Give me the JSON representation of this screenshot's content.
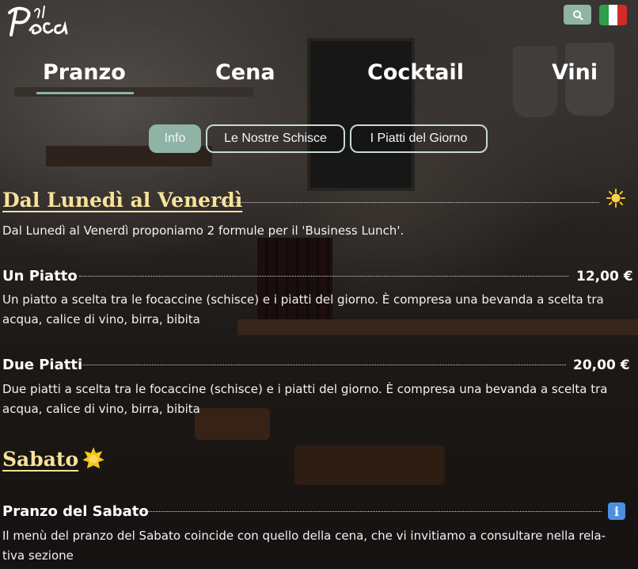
{
  "colors": {
    "accent": "#8fb3a4",
    "title": "#f7e29a",
    "text": "#f2f2f2",
    "sun": "#f5c518",
    "info": "#4a90e2",
    "flag_green": "#2e9e49",
    "flag_white": "#ffffff",
    "flag_red": "#d42a2a"
  },
  "header": {
    "logo_text": "el Peca",
    "search_icon": "search-icon",
    "language_icon": "italian-flag-icon"
  },
  "nav": {
    "items": [
      "Pranzo",
      "Cena",
      "Cocktail",
      "Vini"
    ],
    "active": "Pranzo"
  },
  "subtabs": {
    "items": [
      "Info",
      "Le Nostre Schisce",
      "I Piatti del Giorno"
    ],
    "active": "Info"
  },
  "sections": [
    {
      "title": "Dal Lunedì al Venerdì",
      "icon": "sun-icon",
      "description": "Dal Lunedì al Venerdì proponiamo 2 formule per il 'Business Lunch'.",
      "items": [
        {
          "name": "Un Piatto",
          "price": "12,00 €",
          "description_line1": "Un piatto a scelta tra le focaccine (schisce) e i piatti del giorno. È compresa una bevanda a scelta tra",
          "description_line2": "acqua, calice di vino, birra, bibita"
        },
        {
          "name": "Due Piatti",
          "price": "20,00 €",
          "description_line1": "Due piatti a scelta tra le focaccine (schisce) e i piatti del giorno. È compresa una bevanda a scelta tra",
          "description_line2": "acqua, calice di vino, birra, bibita"
        }
      ]
    },
    {
      "title": "Sabato",
      "icon": "sun-icon",
      "items": [
        {
          "name": "Pranzo del Sabato",
          "icon": "info-icon",
          "info_glyph": "i",
          "description_line1": "Il menù del pranzo del Sabato coincide con quello della cena, che vi invitiamo a consultare nella rela-",
          "description_line2": "tiva sezione"
        }
      ]
    }
  ]
}
